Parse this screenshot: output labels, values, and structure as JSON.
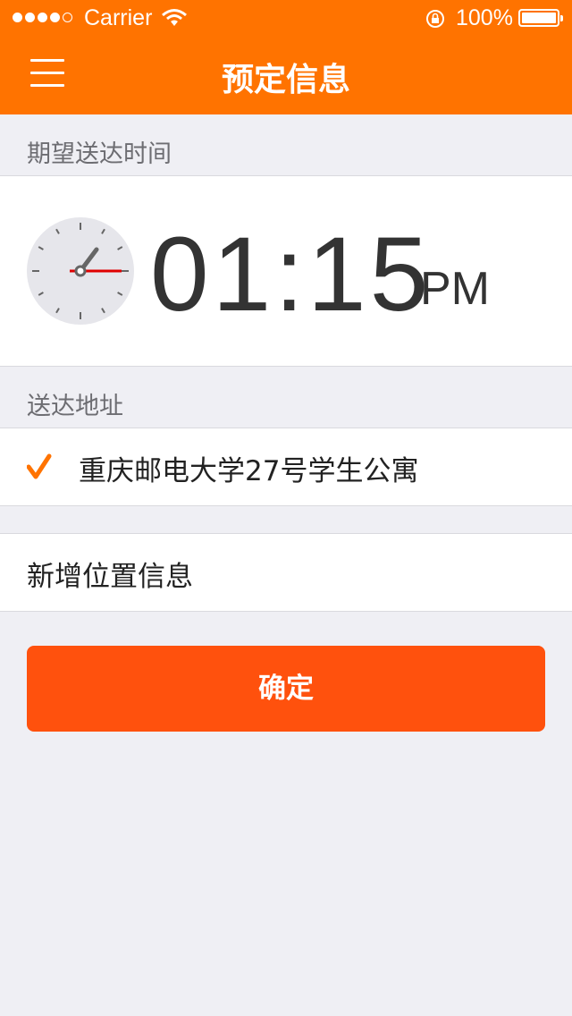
{
  "status_bar": {
    "carrier": "Carrier",
    "battery": "100%",
    "signal_bars": 4,
    "signal_total": 5
  },
  "header": {
    "title": "预定信息",
    "menu_icon": "hamburger-menu-icon",
    "background": "#ff7300"
  },
  "delivery_time": {
    "section_label": "期望送达时间",
    "time": "01:15",
    "period": "PM",
    "clock_icon": "clock-icon"
  },
  "delivery_address": {
    "section_label": "送达地址",
    "selected_address": "重庆邮电大学27号学生公寓",
    "selected_icon": "checkmark-icon"
  },
  "add_location": {
    "label": "新增位置信息"
  },
  "confirm_button": {
    "label": "确定",
    "color": "#ff510d"
  }
}
